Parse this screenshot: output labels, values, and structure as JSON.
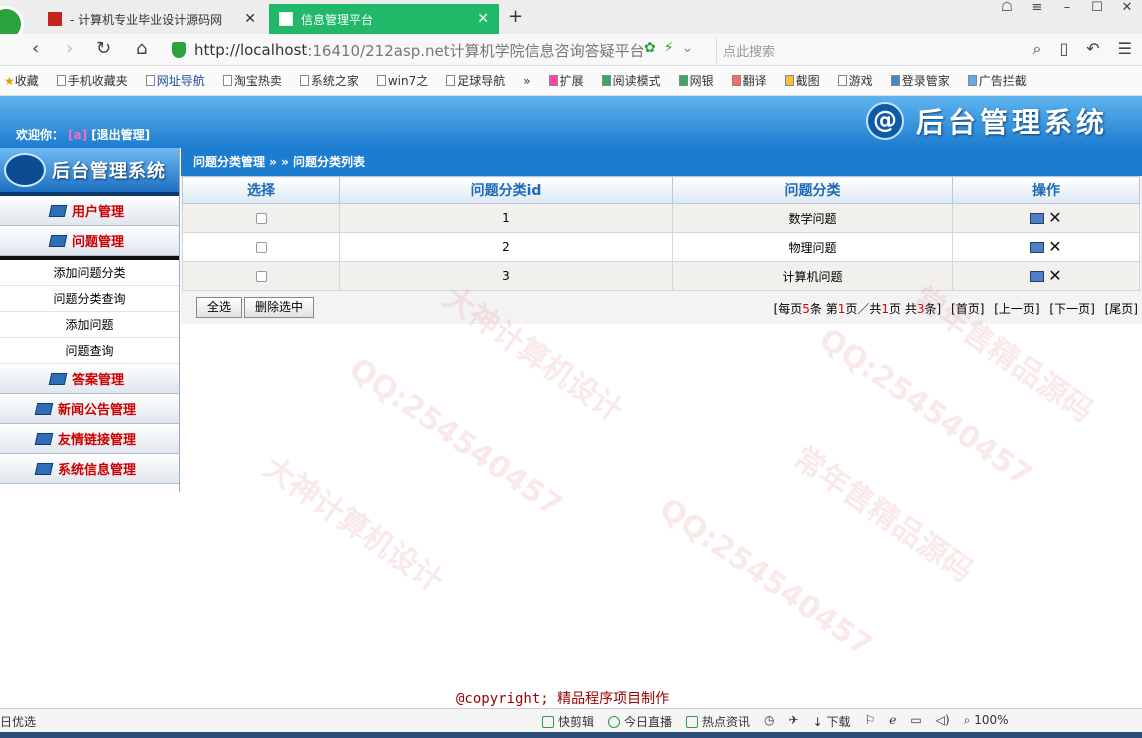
{
  "browser": {
    "tabs": [
      {
        "title": "- 计算机专业毕业设计源码网",
        "close": "✕"
      },
      {
        "title": "信息管理平台",
        "close": "✕"
      }
    ],
    "new_tab": "+",
    "address": {
      "host": "http://localhost",
      "rest": ":16410/212asp.net计算机学院信息咨询答疑平台"
    },
    "search_placeholder": "点此搜索",
    "bookmarks": [
      "收藏",
      "手机收藏夹",
      "网址导航",
      "淘宝热卖",
      "系统之家",
      "win7之",
      "足球导航",
      "»",
      "扩展",
      "阅读模式",
      "网银",
      "翻译",
      "截图",
      "游戏",
      "登录管家",
      "广告拦截"
    ]
  },
  "header": {
    "welcome_label": "欢迎你：",
    "username": "[a]",
    "logout": "[退出管理]",
    "brand_title": "后台管理系统",
    "brand_icon": "@"
  },
  "sidebar": {
    "logo_text": "后台管理系统",
    "menus": [
      {
        "label": "用户管理"
      },
      {
        "label": "问题管理"
      },
      {
        "label": "答案管理"
      },
      {
        "label": "新闻公告管理"
      },
      {
        "label": "友情链接管理"
      },
      {
        "label": "系统信息管理"
      }
    ],
    "submenu": [
      "添加问题分类",
      "问题分类查询",
      "添加问题",
      "问题查询"
    ]
  },
  "breadcrumb": "问题分类管理 » » 问题分类列表",
  "table": {
    "headers": [
      "选择",
      "问题分类id",
      "问题分类",
      "操作"
    ],
    "rows": [
      {
        "id": "1",
        "name": "数学问题"
      },
      {
        "id": "2",
        "name": "物理问题"
      },
      {
        "id": "3",
        "name": "计算机问题"
      }
    ]
  },
  "actions": {
    "select_all": "全选",
    "delete_selected": "删除选中"
  },
  "pager": {
    "prefix": "[每页",
    "per_page": "5",
    "mid1": "条 第",
    "page": "1",
    "mid2": "页／共",
    "total_pages": "1",
    "mid3": "页 共",
    "total": "3",
    "suffix": "条]",
    "first": "[首页]",
    "prev": "[上一页]",
    "next": "[下一页]",
    "last": "[尾页]"
  },
  "copyright": "@copyright; 精品程序项目制作",
  "statusbar": {
    "left": "日优选",
    "items": [
      "快剪辑",
      "今日直播",
      "热点资讯",
      "下载",
      "100%"
    ]
  },
  "watermark": [
    "QQ:254540457",
    "大神计算机设计",
    "常年售精品源码"
  ]
}
